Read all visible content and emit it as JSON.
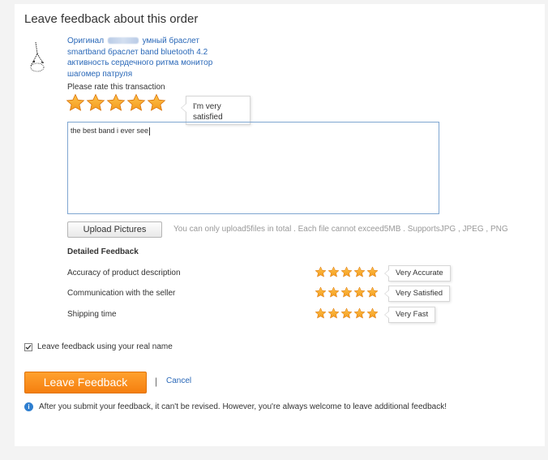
{
  "page": {
    "title": "Leave feedback about this order"
  },
  "product": {
    "name_prefix": "Оригинал",
    "name_rest": "умный браслет smartband браслет band bluetooth 4.2 активность сердечного ритма монитор шагомер патруля",
    "image_icon": "bracelet-image"
  },
  "rating": {
    "label": "Please rate this transaction",
    "stars": 5,
    "max": 5,
    "tooltip": "I'm very satisfied",
    "star_color": "#f39a1e"
  },
  "feedback": {
    "text": "the best band i ever see"
  },
  "upload": {
    "button": "Upload Pictures",
    "note": "You can only upload5files in total . Each file cannot exceed5MB . SupportsJPG , JPEG , PNG"
  },
  "detailed": {
    "title": "Detailed Feedback",
    "rows": [
      {
        "label": "Accuracy of product description",
        "stars": 5,
        "max": 5,
        "rating_text": "Very Accurate"
      },
      {
        "label": "Communication with the seller",
        "stars": 5,
        "max": 5,
        "rating_text": "Very Satisfied"
      },
      {
        "label": "Shipping time",
        "stars": 5,
        "max": 5,
        "rating_text": "Very Fast"
      }
    ]
  },
  "real_name": {
    "label": "Leave feedback using your real name",
    "checked": true
  },
  "actions": {
    "submit": "Leave Feedback",
    "separator": "|",
    "cancel": "Cancel"
  },
  "notice": {
    "text": "After you submit your feedback, it can't be revised. However, you're always welcome to leave additional feedback!"
  },
  "colors": {
    "accent": "#f5870f",
    "link": "#2a68b8",
    "info": "#2f7fd0"
  }
}
